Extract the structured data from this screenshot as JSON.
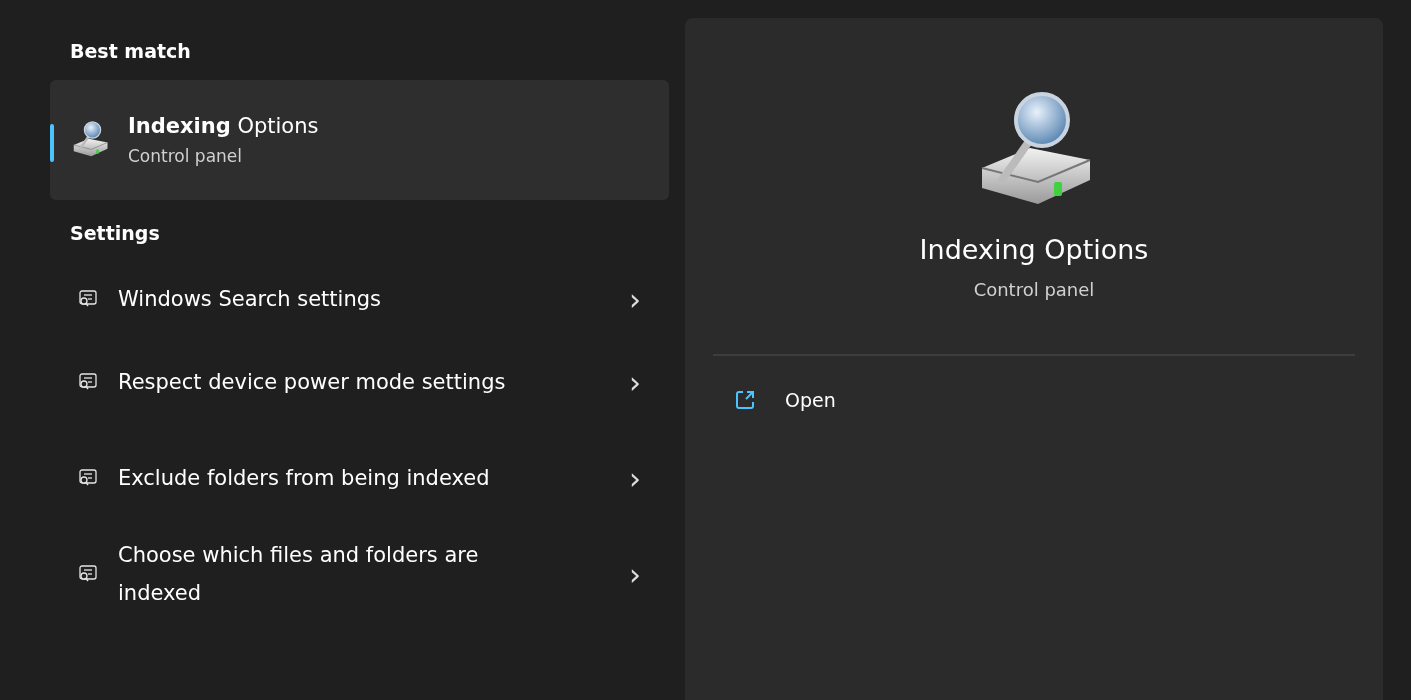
{
  "best_match": {
    "heading": "Best match",
    "title": "**Indexing** Options",
    "subtitle": "Control panel",
    "selected": true
  },
  "settings": {
    "heading": "Settings",
    "items": [
      {
        "label": "Windows Search settings",
        "chevron": "›",
        "selected": false
      },
      {
        "label": "Respect device power mode settings",
        "chevron": "›",
        "selected": false
      },
      {
        "label": "Exclude folders from being indexed",
        "chevron": "›",
        "selected": false
      },
      {
        "label": "Choose which files and folders are indexed",
        "chevron": "›",
        "selected": false
      }
    ]
  },
  "detail": {
    "title": "Indexing Options",
    "subtitle": "Control panel",
    "actions": [
      {
        "label": "Open"
      }
    ]
  }
}
